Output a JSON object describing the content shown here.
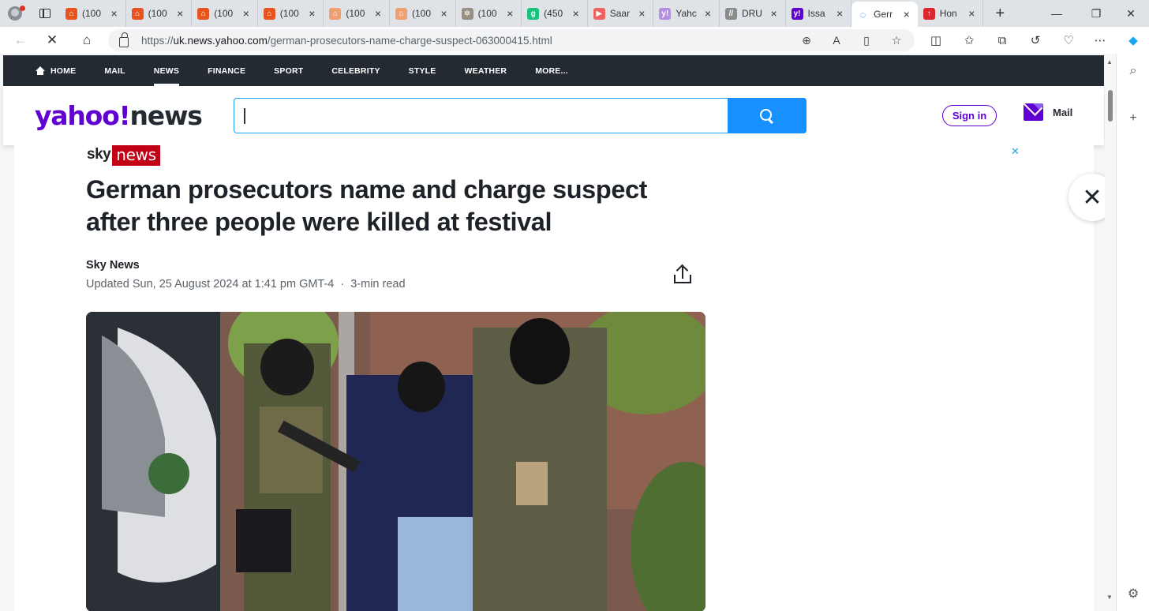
{
  "browser": {
    "tabs": [
      {
        "title": "(100",
        "fav_color": "#e8541e",
        "fav_glyph": "⌂"
      },
      {
        "title": "(100",
        "fav_color": "#e8541e",
        "fav_glyph": "⌂"
      },
      {
        "title": "(100",
        "fav_color": "#e8541e",
        "fav_glyph": "⌂"
      },
      {
        "title": "(100",
        "fav_color": "#e8541e",
        "fav_glyph": "⌂"
      },
      {
        "title": "(100",
        "fav_color": "#f0a070",
        "fav_glyph": "⌂"
      },
      {
        "title": "(100",
        "fav_color": "#f0a070",
        "fav_glyph": "⌂"
      },
      {
        "title": "(100",
        "fav_color": "#9a8f80",
        "fav_glyph": "✲"
      },
      {
        "title": "(450",
        "fav_color": "#19c37d",
        "fav_glyph": "g"
      },
      {
        "title": "Saar",
        "fav_color": "#f06262",
        "fav_glyph": "▶"
      },
      {
        "title": "Yahc",
        "fav_color": "#b48fe0",
        "fav_glyph": "y!"
      },
      {
        "title": "DRU",
        "fav_color": "#8a8a8a",
        "fav_glyph": "//"
      },
      {
        "title": "Issa",
        "fav_color": "#6001d2",
        "fav_glyph": "y!"
      },
      {
        "title": "Gerr",
        "fav_color": "#ffffff",
        "fav_glyph": "◌",
        "active": true
      },
      {
        "title": "Hon",
        "fav_color": "#d9272e",
        "fav_glyph": "↑"
      }
    ],
    "url_prefix": "https://",
    "url_host": "uk.news.yahoo.com",
    "url_path": "/german-prosecutors-name-charge-suspect-063000415.html"
  },
  "yahoo": {
    "nav": [
      {
        "label": "HOME",
        "icon": "home-icon"
      },
      {
        "label": "MAIL"
      },
      {
        "label": "NEWS",
        "active": true
      },
      {
        "label": "FINANCE"
      },
      {
        "label": "SPORT"
      },
      {
        "label": "CELEBRITY"
      },
      {
        "label": "STYLE"
      },
      {
        "label": "WEATHER"
      },
      {
        "label": "MORE..."
      }
    ],
    "logo_yahoo": "yahoo!",
    "logo_news": "news",
    "search_value": "",
    "signin_label": "Sign in",
    "mail_label": "Mail",
    "brand_purple": "#6001d2",
    "search_blue": "#1890ff"
  },
  "article": {
    "source_logo_sky": "sky",
    "source_logo_news": "news",
    "headline": "German prosecutors name and charge suspect after three people were killed at festival",
    "byline": "Sky News",
    "updated": "Updated Sun, 25 August 2024 at 1:41 pm GMT-4",
    "separator": "·",
    "read_time": "3-min read",
    "ad_close": "✕",
    "overlay_close": "✕"
  }
}
